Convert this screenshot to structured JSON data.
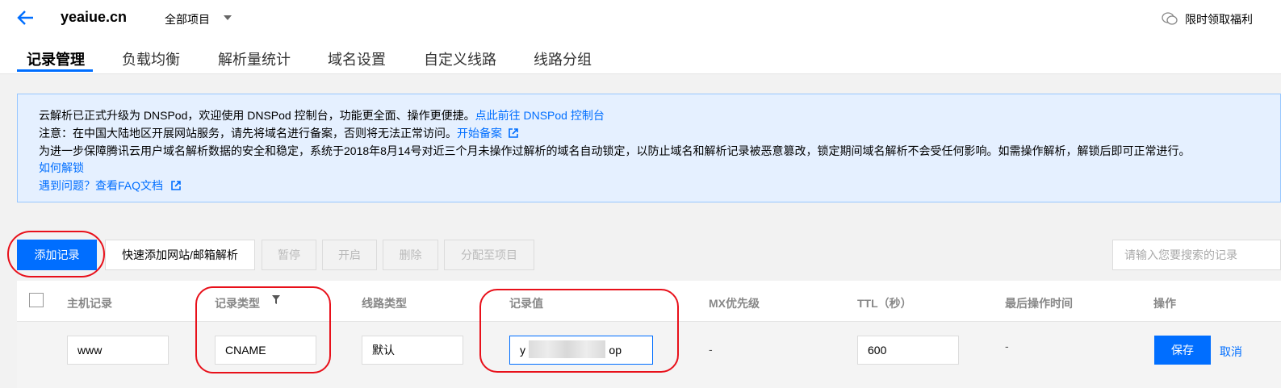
{
  "header": {
    "domain": "yeaiue.cn",
    "project_selector": "全部项目",
    "promo": "限时领取福利"
  },
  "tabs": [
    "记录管理",
    "负载均衡",
    "解析量统计",
    "域名设置",
    "自定义线路",
    "线路分组"
  ],
  "notice": {
    "line1_text": "云解析已正式升级为 DNSPod，欢迎使用 DNSPod 控制台，功能更全面、操作更便捷。",
    "line1_link": "点此前往 DNSPod 控制台",
    "line2_text": "注意：在中国大陆地区开展网站服务，请先将域名进行备案，否则将无法正常访问。",
    "line2_link": "开始备案",
    "line3_text": "为进一步保障腾讯云用户域名解析数据的安全和稳定，系统于2018年8月14号对近三个月未操作过解析的域名自动锁定，以防止域名和解析记录被恶意篡改，锁定期间域名解析不会受任何影响。如需操作解析，解锁后即可正常进行。",
    "line4_link": "如何解锁",
    "line5_text": "遇到问题？",
    "line5_link": "查看FAQ文档"
  },
  "toolbar": {
    "add": "添加记录",
    "quick_add": "快速添加网站/邮箱解析",
    "pause": "暂停",
    "enable": "开启",
    "delete": "删除",
    "assign": "分配至项目",
    "search_placeholder": "请输入您要搜索的记录"
  },
  "table": {
    "headers": [
      "主机记录",
      "记录类型",
      "线路类型",
      "记录值",
      "MX优先级",
      "TTL（秒）",
      "最后操作时间",
      "操作"
    ],
    "row": {
      "host": "www",
      "type": "CNAME",
      "line": "默认",
      "value_prefix": "y",
      "value_suffix": "op",
      "mx": "-",
      "ttl": "600",
      "last_modified": "-",
      "save": "保存",
      "cancel": "取消"
    }
  },
  "colors": {
    "accent": "#006eff",
    "annotation_ring": "#e8101a",
    "notice_bg": "#e5f0ff"
  }
}
